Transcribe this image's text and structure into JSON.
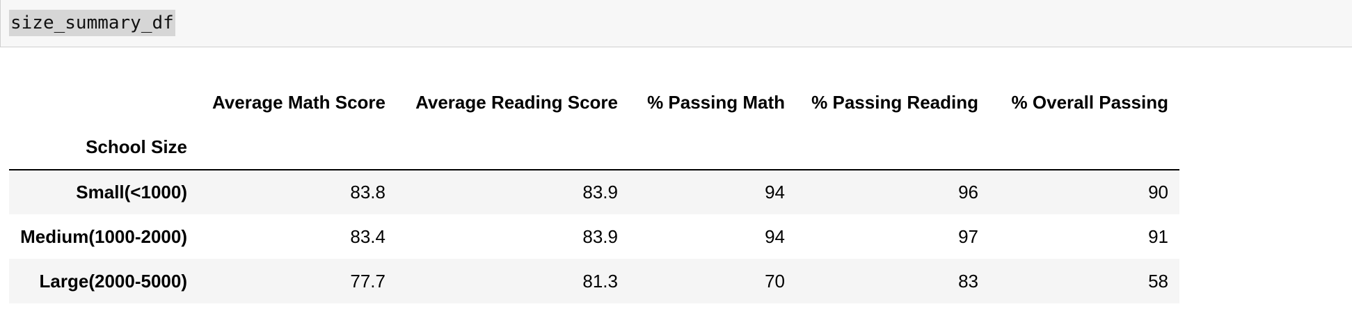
{
  "input_cell": {
    "code": "size_summary_df"
  },
  "table": {
    "columns": [
      "Average Math Score",
      "Average Reading Score",
      "% Passing Math",
      "% Passing Reading",
      "% Overall Passing"
    ],
    "index_name": "School Size",
    "rows": [
      {
        "label": "Small(<1000)",
        "values": [
          "83.8",
          "83.9",
          "94",
          "96",
          "90"
        ]
      },
      {
        "label": "Medium(1000-2000)",
        "values": [
          "83.4",
          "83.9",
          "94",
          "97",
          "91"
        ]
      },
      {
        "label": "Large(2000-5000)",
        "values": [
          "77.7",
          "81.3",
          "70",
          "83",
          "58"
        ]
      }
    ]
  },
  "colors": {
    "input_background": "#f7f7f7",
    "code_highlight": "#d6d6d6",
    "row_stripe": "#f5f5f5",
    "header_rule": "#000000"
  }
}
